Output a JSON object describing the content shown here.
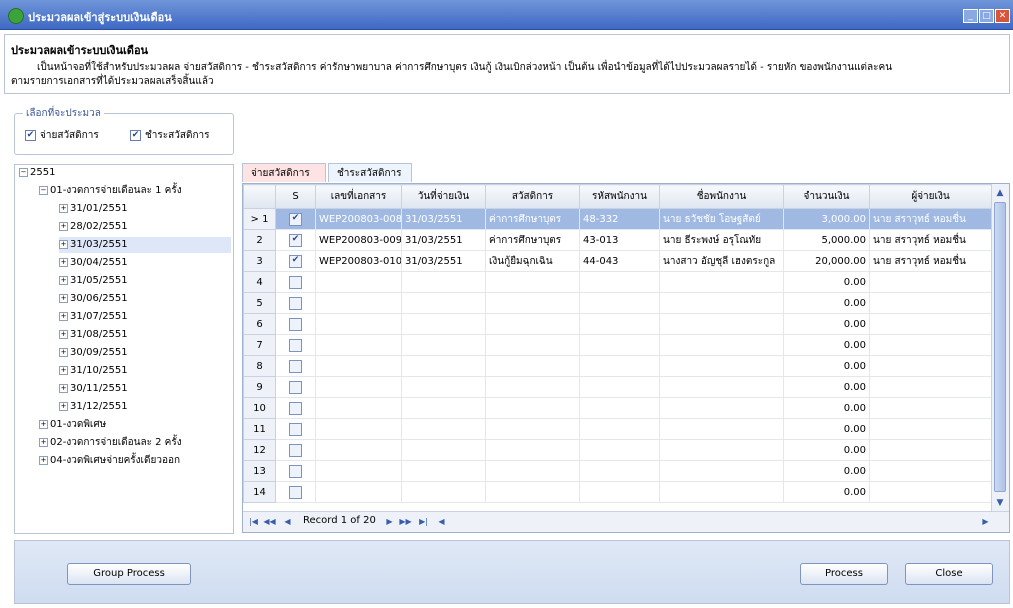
{
  "window": {
    "title": "ประมวลผลเข้าสู่ระบบเงินเดือน"
  },
  "header": {
    "title": "ประมวลผลเข้าระบบเงินเดือน",
    "desc_line1": "เป็นหน้าจอที่ใช้สำหรับประมวลผล จ่ายสวัสดิการ - ชำระสวัสดิการ ค่ารักษาพยาบาล ค่าการศึกษาบุตร เงินกู้ เงินเบิกล่วงหน้า เป็นต้น เพื่อนำข้อมูลที่ได้ไปประมวลผลรายได้ - รายหัก ของพนักงานแต่ละคน",
    "desc_line2": "ตามรายการเอกสารที่ได้ประมวลผลเสร็จสิ้นแล้ว"
  },
  "process_group": {
    "legend": "เลือกที่จะประมวล",
    "opt_pay": "จ่ายสวัสดิการ",
    "opt_settle": "ชำระสวัสดิการ"
  },
  "tree": {
    "root": "2551",
    "group1": "01-งวดการจ่ายเดือนละ 1 ครั้ง",
    "dates": [
      "31/01/2551",
      "28/02/2551",
      "31/03/2551",
      "30/04/2551",
      "31/05/2551",
      "30/06/2551",
      "31/07/2551",
      "31/08/2551",
      "30/09/2551",
      "31/10/2551",
      "30/11/2551",
      "31/12/2551"
    ],
    "group2": "01-งวดพิเศษ",
    "group3": "02-งวดการจ่ายเดือนละ 2 ครั้ง",
    "group4": "04-งวดพิเศษจ่ายครั้งเดียวออก"
  },
  "tabs": {
    "pay": "จ่ายสวัสดิการ",
    "settle": "ชำระสวัสดิการ"
  },
  "grid": {
    "columns": [
      "S",
      "เลขที่เอกสาร",
      "วันที่จ่ายเงิน",
      "สวัสดิการ",
      "รหัสพนักงาน",
      "ชื่อพนักงาน",
      "จำนวนเงิน",
      "ผู้จ่ายเงิน"
    ],
    "rows": [
      {
        "n": "1",
        "doc": "WEP200803-008",
        "date": "31/03/2551",
        "welfare": "ค่าการศึกษาบุตร",
        "emp": "48-332",
        "name": "นาย ธวัชชัย โอษฐสัตย์",
        "amount": "3,000.00",
        "payer": "นาย สราวุทธ์ หอมชื่น"
      },
      {
        "n": "2",
        "doc": "WEP200803-009",
        "date": "31/03/2551",
        "welfare": "ค่าการศึกษาบุตร",
        "emp": "43-013",
        "name": "นาย ธีระพงษ์ อรุโณทัย",
        "amount": "5,000.00",
        "payer": "นาย สราวุทธ์ หอมชื่น"
      },
      {
        "n": "3",
        "doc": "WEP200803-010",
        "date": "31/03/2551",
        "welfare": "เงินกู้ยืมฉุกเฉิน",
        "emp": "44-043",
        "name": "นางสาว อัญชุลี เฮงตระกูล",
        "amount": "20,000.00",
        "payer": "นาย สราวุทธ์ หอมชื่น"
      },
      {
        "n": "4",
        "amount": "0.00"
      },
      {
        "n": "5",
        "amount": "0.00"
      },
      {
        "n": "6",
        "amount": "0.00"
      },
      {
        "n": "7",
        "amount": "0.00"
      },
      {
        "n": "8",
        "amount": "0.00"
      },
      {
        "n": "9",
        "amount": "0.00"
      },
      {
        "n": "10",
        "amount": "0.00"
      },
      {
        "n": "11",
        "amount": "0.00"
      },
      {
        "n": "12",
        "amount": "0.00"
      },
      {
        "n": "13",
        "amount": "0.00"
      },
      {
        "n": "14",
        "amount": "0.00"
      }
    ],
    "record_text": "Record 1 of 20",
    "current_marker": ">"
  },
  "buttons": {
    "group_process": "Group Process",
    "process": "Process",
    "close": "Close"
  }
}
